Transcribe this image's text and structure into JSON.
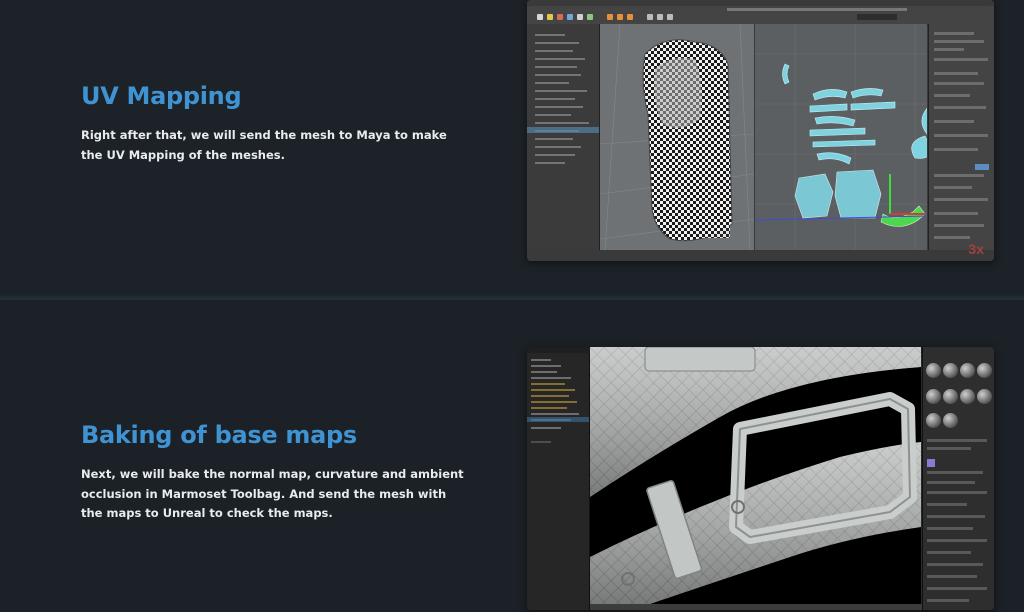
{
  "sections": [
    {
      "heading": "UV Mapping",
      "body": "Right after that, we will send the mesh to Maya to make the UV Mapping of the meshes."
    },
    {
      "heading": "Baking of base maps",
      "body": "Next, we will bake the normal map, curvature and ambient occlusion in Marmoset Toolbag. And send the mesh with the maps to Unreal to check the maps."
    }
  ],
  "screenshots": {
    "maya_watermark": "3x"
  },
  "colors": {
    "page_bg": "#1c2227",
    "heading": "#3f93d3",
    "body_text": "#e8ecef",
    "uv_shell": "#7fd3e0",
    "uv_selected": "#4fd64f"
  },
  "icons": [
    "screenshot-maya-image",
    "screenshot-marmoset-image"
  ]
}
